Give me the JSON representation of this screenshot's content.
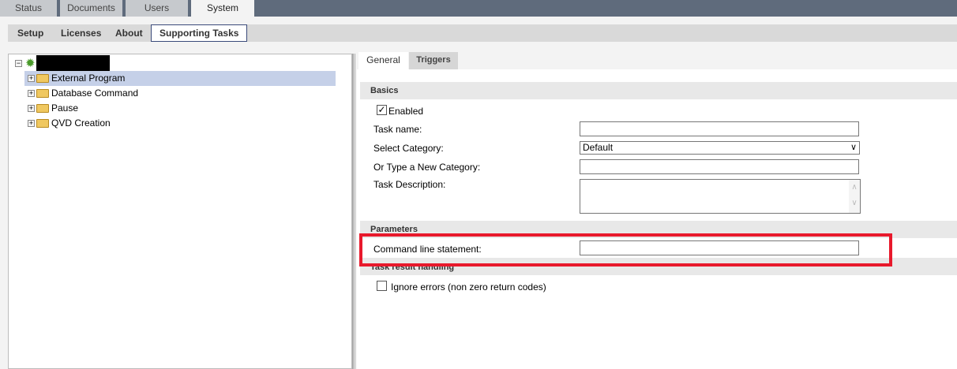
{
  "top_tabs": [
    {
      "label": "Status"
    },
    {
      "label": "Documents"
    },
    {
      "label": "Users"
    },
    {
      "label": "System",
      "active": true
    }
  ],
  "sub_tabs": [
    {
      "label": "Setup"
    },
    {
      "label": "Licenses"
    },
    {
      "label": "About"
    },
    {
      "label": "Supporting Tasks",
      "active": true
    }
  ],
  "tree": {
    "root_label_redacted": true,
    "items": [
      {
        "label": "External Program",
        "selected": true
      },
      {
        "label": "Database Command"
      },
      {
        "label": "Pause"
      },
      {
        "label": "QVD Creation"
      }
    ]
  },
  "detail_tabs": [
    {
      "label": "General",
      "active": true
    },
    {
      "label": "Triggers"
    }
  ],
  "basics": {
    "header": "Basics",
    "enabled_label": "Enabled",
    "enabled": true,
    "task_name_label": "Task name:",
    "task_name_value": "",
    "category_label": "Select Category:",
    "category_value": "Default",
    "new_category_label": "Or Type a New Category:",
    "new_category_value": "",
    "description_label": "Task Description:",
    "description_value": ""
  },
  "parameters": {
    "header": "Parameters",
    "command_label": "Command line statement:",
    "command_value": ""
  },
  "result": {
    "header": "Task result handling",
    "ignore_errors_label": "Ignore errors (non zero return codes)",
    "ignore_errors": false
  },
  "colors": {
    "highlight": "#e8192c",
    "selected_row": "#c5d0e8",
    "topbar": "#5f6b7c"
  }
}
